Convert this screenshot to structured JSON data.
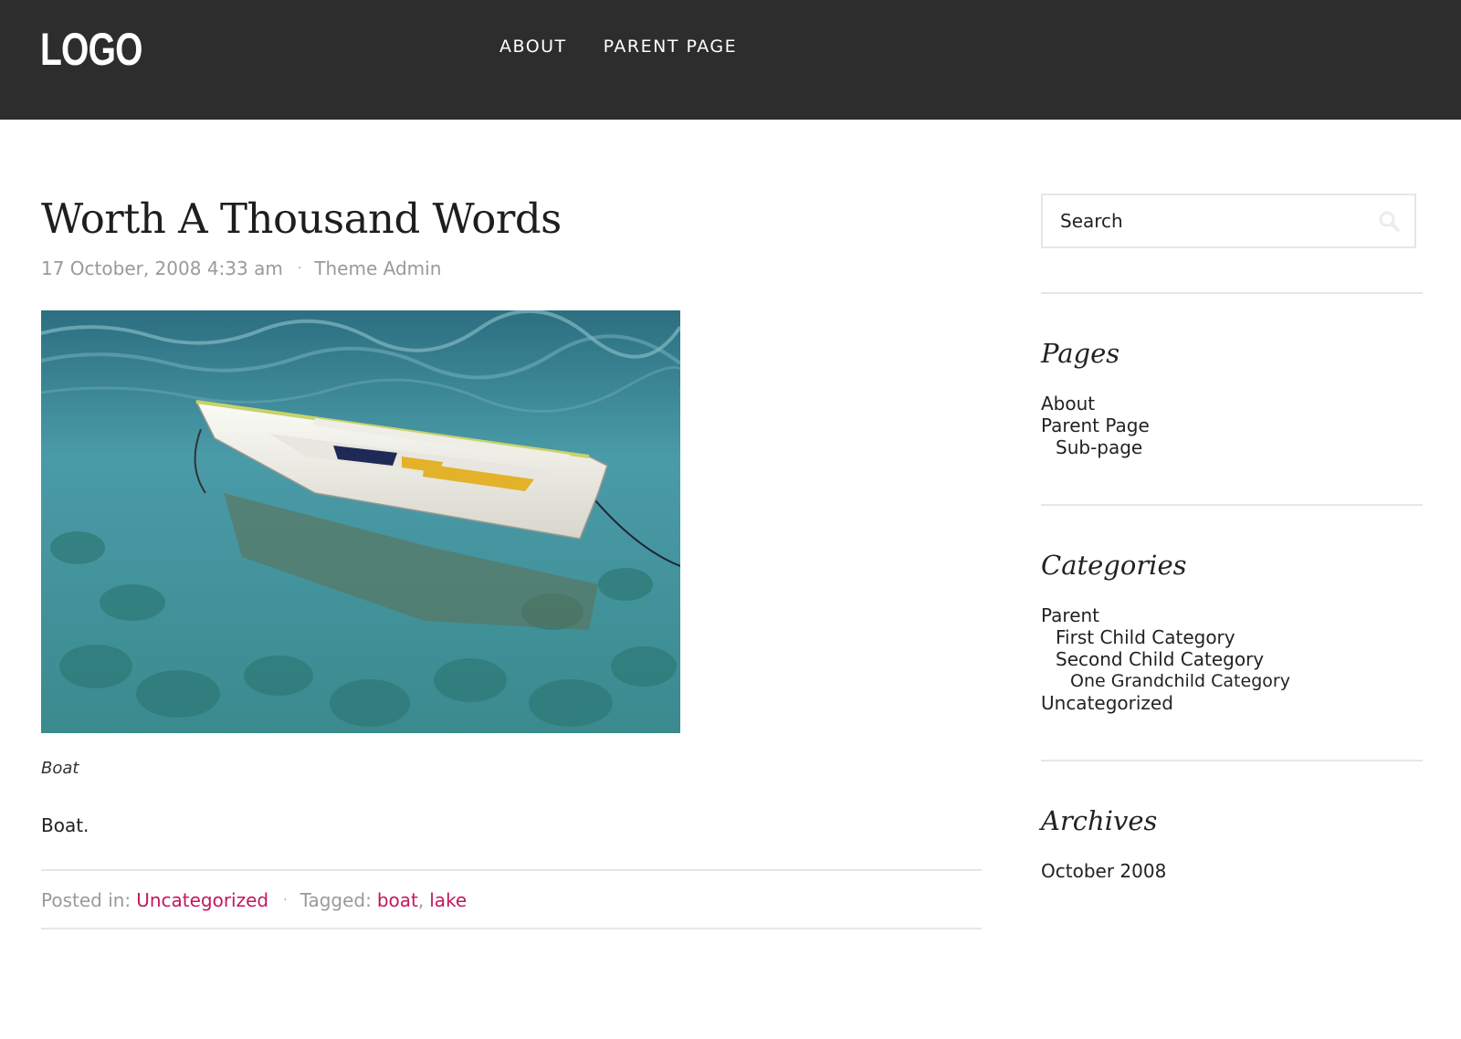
{
  "header": {
    "logo": "LOGO",
    "nav": [
      {
        "label": "ABOUT"
      },
      {
        "label": "PARENT PAGE"
      }
    ]
  },
  "post": {
    "title": "Worth A Thousand Words",
    "date": "17 October, 2008 4:33 am",
    "meta_separator": "·",
    "author": "Theme Admin",
    "image_alt": "Boat",
    "caption": "Boat",
    "body": "Boat.",
    "footer": {
      "posted_in_label": "Posted in:",
      "category": "Uncategorized",
      "tagged_label": "Tagged:",
      "tags": [
        "boat",
        "lake"
      ],
      "tag_separator": ","
    }
  },
  "sidebar": {
    "search": {
      "placeholder": "Search"
    },
    "pages": {
      "title": "Pages",
      "items": [
        {
          "label": "About"
        },
        {
          "label": "Parent Page"
        },
        {
          "label": "Sub-page"
        }
      ]
    },
    "categories": {
      "title": "Categories",
      "items": [
        {
          "label": "Parent"
        },
        {
          "label": "First Child Category"
        },
        {
          "label": "Second Child Category"
        },
        {
          "label": "One Grandchild Category"
        },
        {
          "label": "Uncategorized"
        }
      ]
    },
    "archives": {
      "title": "Archives",
      "items": [
        {
          "label": "October 2008"
        }
      ]
    }
  },
  "colors": {
    "header_bg": "#2d2d2d",
    "link_accent": "#c2185b",
    "meta_text": "#9a9a9a",
    "divider": "#e6e6e6"
  }
}
